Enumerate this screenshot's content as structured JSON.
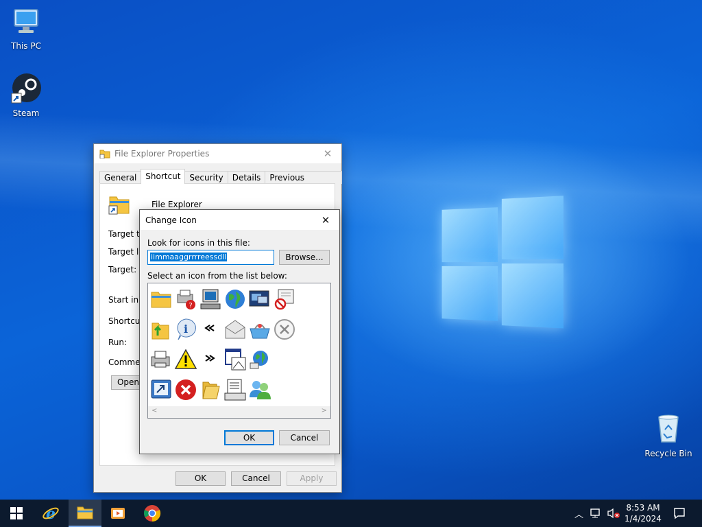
{
  "desktop": {
    "icons": [
      {
        "label": "This PC"
      },
      {
        "label": "Steam"
      },
      {
        "label": "Recycle Bin"
      }
    ]
  },
  "props_window": {
    "title": "File Explorer Properties",
    "tabs": [
      "General",
      "Shortcut",
      "Security",
      "Details",
      "Previous Versions"
    ],
    "active_tab": "Shortcut",
    "app_name": "File Explorer",
    "fields": [
      "Target typ",
      "Target loc",
      "Target:",
      "Start in:",
      "Shortcut k",
      "Run:",
      "Comment:"
    ],
    "open_button": "Open",
    "ok": "OK",
    "cancel": "Cancel",
    "apply": "Apply"
  },
  "change_icon": {
    "title": "Change Icon",
    "look_label": "Look for icons in this file:",
    "file_value": "iimmaaggrrrreessdll",
    "browse": "Browse...",
    "select_label": "Select an icon from the list below:",
    "ok": "OK",
    "cancel": "Cancel",
    "icons": [
      "folder-icon",
      "printer-help-icon",
      "computer-icon",
      "globe-icon",
      "windows-stack-icon",
      "blocked-window-icon",
      "folder-up-icon",
      "info-icon",
      "double-left-icon",
      "envelope-icon",
      "basket-icon",
      "close-circle-icon",
      "printer-icon",
      "warning-icon",
      "double-right-icon",
      "window-chart-icon",
      "globe-network-icon",
      "monitor-arrow-icon",
      "error-icon",
      "folder-open-icon",
      "document-window-icon",
      "users-icon"
    ]
  },
  "taskbar": {
    "time": "8:53 AM",
    "date": "1/4/2024"
  },
  "colors": {
    "accent": "#0078d7",
    "taskbar": "#0c1a2e",
    "desktop": "#0b64d8"
  }
}
